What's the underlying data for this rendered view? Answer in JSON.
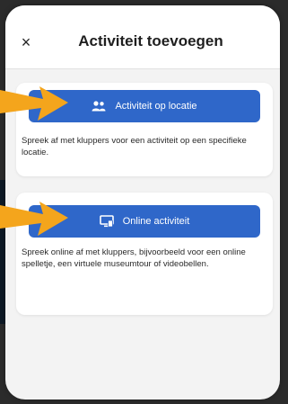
{
  "header": {
    "close_symbol": "×",
    "title": "Activiteit toevoegen"
  },
  "options": [
    {
      "button_label": "Activiteit op locatie",
      "icon": "people-icon",
      "description": "Spreek af met kluppers voor een activiteit op een specifieke locatie."
    },
    {
      "button_label": "Online activiteit",
      "icon": "screen-icon",
      "description": "Spreek online af met kluppers, bijvoorbeeld voor een online spelletje, een virtuele museumtour of videobellen."
    }
  ],
  "colors": {
    "button_blue": "#2f67c9",
    "arrow_orange": "#f4a51c"
  }
}
